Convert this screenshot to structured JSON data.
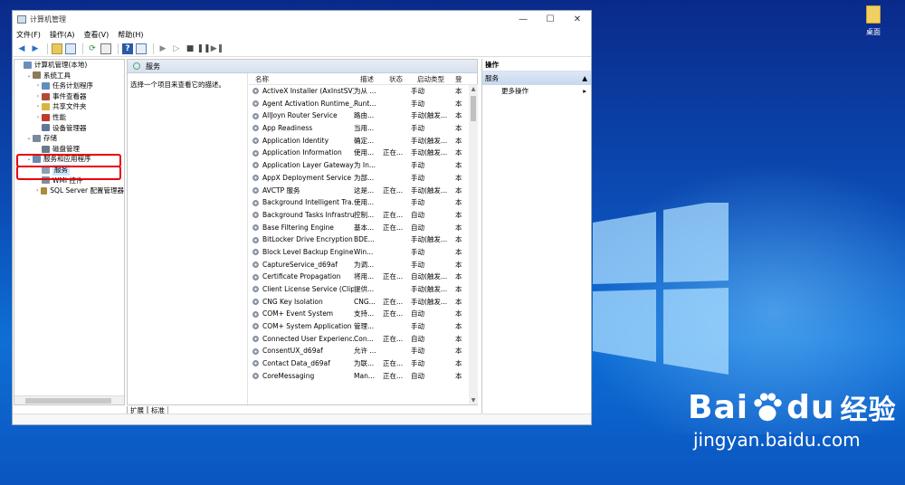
{
  "window": {
    "title": "计算机管理",
    "controls": {
      "minimize": "—",
      "maximize": "☐",
      "close": "✕"
    }
  },
  "menu": [
    "文件(F)",
    "操作(A)",
    "查看(V)",
    "帮助(H)"
  ],
  "tree": [
    {
      "label": "计算机管理(本地)",
      "indent": 0,
      "arrow": "",
      "color": "#6b8fb8"
    },
    {
      "label": "系统工具",
      "indent": 1,
      "arrow": "⌄",
      "color": "#8c7a5a"
    },
    {
      "label": "任务计划程序",
      "indent": 2,
      "arrow": "›",
      "color": "#5f8fbf"
    },
    {
      "label": "事件查看器",
      "indent": 2,
      "arrow": "›",
      "color": "#b04a3a"
    },
    {
      "label": "共享文件夹",
      "indent": 2,
      "arrow": "›",
      "color": "#d9b441"
    },
    {
      "label": "性能",
      "indent": 2,
      "arrow": "›",
      "color": "#c0392b"
    },
    {
      "label": "设备管理器",
      "indent": 2,
      "arrow": "",
      "color": "#5d7a9c"
    },
    {
      "label": "存储",
      "indent": 1,
      "arrow": "⌄",
      "color": "#7a8a9a"
    },
    {
      "label": "磁盘管理",
      "indent": 2,
      "arrow": "",
      "color": "#6a7a8a"
    },
    {
      "label": "服务和应用程序",
      "indent": 1,
      "arrow": "⌄",
      "color": "#6a8ab0"
    },
    {
      "label": "服务",
      "indent": 2,
      "arrow": "",
      "color": "#8aa0b8",
      "selected": true
    },
    {
      "label": "WMI 控件",
      "indent": 2,
      "arrow": "",
      "color": "#7f8f9f"
    },
    {
      "label": "SQL Server 配置管理器",
      "indent": 2,
      "arrow": "›",
      "color": "#b08a3a"
    }
  ],
  "center": {
    "title": "服务",
    "description": "选择一个项目来查看它的描述。",
    "columns": [
      "名称",
      "描述",
      "状态",
      "启动类型",
      "登"
    ],
    "services": [
      {
        "name": "ActiveX Installer (AxInstSV)",
        "desc": "为从 ...",
        "state": "",
        "start": "手动",
        "login": "本"
      },
      {
        "name": "Agent Activation Runtime_...",
        "desc": "Runt...",
        "state": "",
        "start": "手动",
        "login": "本"
      },
      {
        "name": "AllJoyn Router Service",
        "desc": "路由...",
        "state": "",
        "start": "手动(触发...",
        "login": "本"
      },
      {
        "name": "App Readiness",
        "desc": "当用...",
        "state": "",
        "start": "手动",
        "login": "本"
      },
      {
        "name": "Application Identity",
        "desc": "确定...",
        "state": "",
        "start": "手动(触发...",
        "login": "本"
      },
      {
        "name": "Application Information",
        "desc": "使用...",
        "state": "正在...",
        "start": "手动(触发...",
        "login": "本"
      },
      {
        "name": "Application Layer Gateway ...",
        "desc": "为 In...",
        "state": "",
        "start": "手动",
        "login": "本"
      },
      {
        "name": "AppX Deployment Service ...",
        "desc": "为部...",
        "state": "",
        "start": "手动",
        "login": "本"
      },
      {
        "name": "AVCTP 服务",
        "desc": "这是...",
        "state": "正在...",
        "start": "手动(触发...",
        "login": "本"
      },
      {
        "name": "Background Intelligent Tra...",
        "desc": "使用...",
        "state": "",
        "start": "手动",
        "login": "本"
      },
      {
        "name": "Background Tasks Infrastru...",
        "desc": "控制...",
        "state": "正在...",
        "start": "自动",
        "login": "本"
      },
      {
        "name": "Base Filtering Engine",
        "desc": "基本...",
        "state": "正在...",
        "start": "自动",
        "login": "本"
      },
      {
        "name": "BitLocker Drive Encryption ...",
        "desc": "BDE...",
        "state": "",
        "start": "手动(触发...",
        "login": "本"
      },
      {
        "name": "Block Level Backup Engine ...",
        "desc": "Win...",
        "state": "",
        "start": "手动",
        "login": "本"
      },
      {
        "name": "CaptureService_d69af",
        "desc": "为调...",
        "state": "",
        "start": "手动",
        "login": "本"
      },
      {
        "name": "Certificate Propagation",
        "desc": "将用...",
        "state": "正在...",
        "start": "自动(触发...",
        "login": "本"
      },
      {
        "name": "Client License Service (Clip...",
        "desc": "提供...",
        "state": "",
        "start": "手动(触发...",
        "login": "本"
      },
      {
        "name": "CNG Key Isolation",
        "desc": "CNG...",
        "state": "正在...",
        "start": "手动(触发...",
        "login": "本"
      },
      {
        "name": "COM+ Event System",
        "desc": "支持...",
        "state": "正在...",
        "start": "自动",
        "login": "本"
      },
      {
        "name": "COM+ System Application",
        "desc": "管理...",
        "state": "",
        "start": "手动",
        "login": "本"
      },
      {
        "name": "Connected User Experienc...",
        "desc": "Con...",
        "state": "正在...",
        "start": "自动",
        "login": "本"
      },
      {
        "name": "ConsentUX_d69af",
        "desc": "允许 ...",
        "state": "",
        "start": "手动",
        "login": "本"
      },
      {
        "name": "Contact Data_d69af",
        "desc": "为联...",
        "state": "正在...",
        "start": "手动",
        "login": "本"
      },
      {
        "name": "CoreMessaging",
        "desc": "Man...",
        "state": "正在...",
        "start": "自动",
        "login": "本"
      }
    ],
    "tabs": [
      "扩展",
      "标准"
    ]
  },
  "actions": {
    "title": "操作",
    "group": "服务",
    "items": [
      "更多操作"
    ]
  },
  "desktop": {
    "icon_label": "桌面",
    "watermark_logo_left": "Bai",
    "watermark_logo_right": "du",
    "watermark_cn": "经验",
    "watermark_url": "jingyan.baidu.com"
  },
  "colors": {
    "highlight_box": "#e8000b",
    "desktop_blue": "#0b4fb8"
  }
}
